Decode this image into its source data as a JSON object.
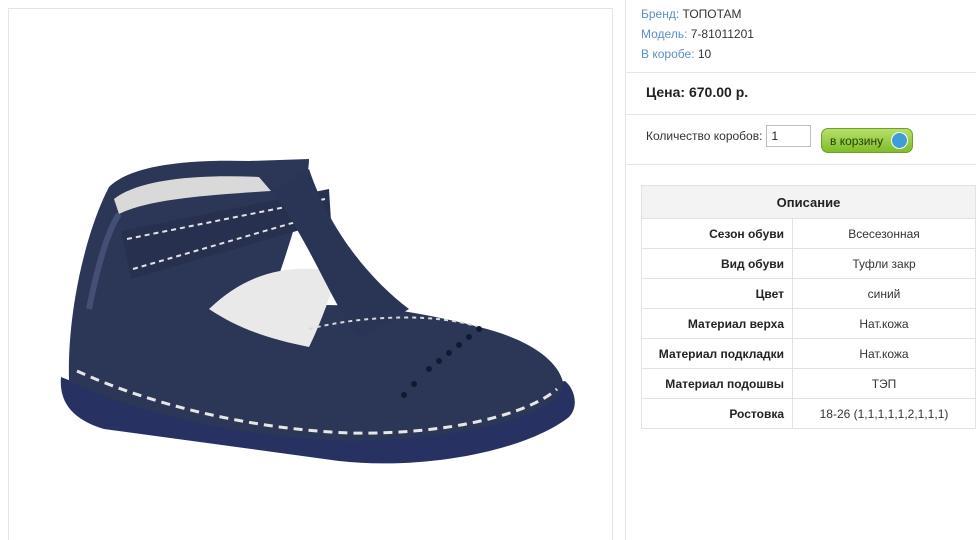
{
  "product": {
    "image_alt": "Детские туфли синего цвета",
    "info": [
      {
        "label": "Бренд:",
        "value": "ТОПОТАМ"
      },
      {
        "label": "Модель:",
        "value": "7-81011201"
      },
      {
        "label": "В коробе:",
        "value": "10"
      }
    ],
    "price": "Цена: 670.00 р.",
    "quantity_label": "Количество коробов:",
    "quantity_value": "1",
    "cart_button": "в корзину"
  },
  "spec": {
    "title": "Описание",
    "rows": [
      {
        "key": "Сезон обуви",
        "value": "Всесезонная"
      },
      {
        "key": "Вид обуви",
        "value": "Туфли закр"
      },
      {
        "key": "Цвет",
        "value": "синий"
      },
      {
        "key": "Материал верха",
        "value": "Нат.кожа"
      },
      {
        "key": "Материал подкладки",
        "value": "Нат.кожа"
      },
      {
        "key": "Материал подошвы",
        "value": "ТЭП"
      },
      {
        "key": "Ростовка",
        "value": "18-26 (1,1,1,1,1,2,1,1,1)"
      }
    ]
  },
  "colors": {
    "label_blue": "#5b8fc7",
    "shoe_navy": "#2b3555",
    "button_green": "#8cc63f"
  }
}
